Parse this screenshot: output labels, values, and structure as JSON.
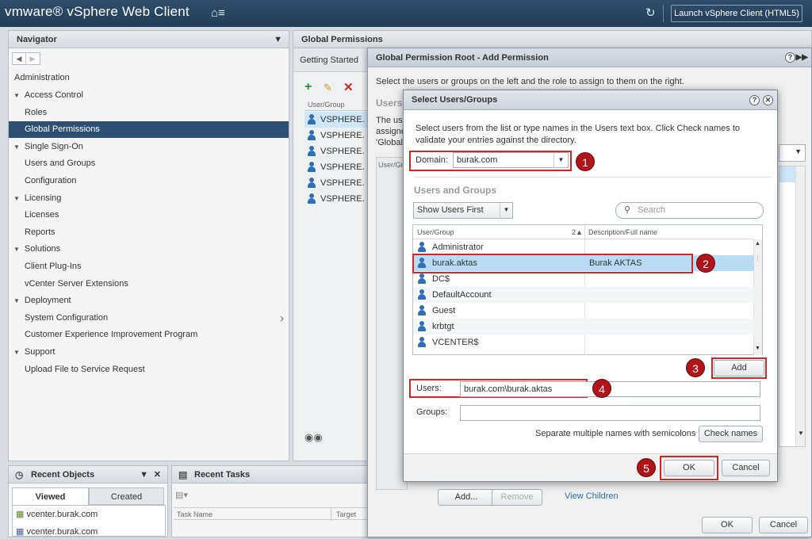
{
  "app": {
    "brand": "vmware® vSphere Web Client",
    "launch_html5": "Launch vSphere Client (HTML5)"
  },
  "navigator": {
    "title": "Navigator",
    "section": "Administration",
    "items": [
      {
        "label": "Access Control",
        "group": true
      },
      {
        "label": "Roles"
      },
      {
        "label": "Global Permissions",
        "selected": true
      },
      {
        "label": "Single Sign-On",
        "group": true
      },
      {
        "label": "Users and Groups"
      },
      {
        "label": "Configuration"
      },
      {
        "label": "Licensing",
        "group": true
      },
      {
        "label": "Licenses"
      },
      {
        "label": "Reports"
      },
      {
        "label": "Solutions",
        "group": true
      },
      {
        "label": "Client Plug-Ins"
      },
      {
        "label": "vCenter Server Extensions"
      },
      {
        "label": "Deployment",
        "group": true
      },
      {
        "label": "System Configuration"
      },
      {
        "label": "Customer Experience Improvement Program"
      },
      {
        "label": "Support",
        "group": true
      },
      {
        "label": "Upload File to Service Request"
      }
    ]
  },
  "global_permissions": {
    "title": "Global Permissions",
    "tab": "Getting Started",
    "list_header": "User/Group",
    "rows": [
      "VSPHERE.",
      "VSPHERE.",
      "VSPHERE.",
      "VSPHERE.",
      "VSPHERE.",
      "VSPHERE."
    ],
    "partial_heading": "Users",
    "partial_text": [
      "The us",
      "assigne",
      "'Global"
    ],
    "partial_col": "User/Gr"
  },
  "recent_objects": {
    "title": "Recent Objects",
    "tabs": [
      "Viewed",
      "Created"
    ],
    "items": [
      "vcenter.burak.com",
      "vcenter.burak.com"
    ]
  },
  "recent_tasks": {
    "title": "Recent Tasks",
    "columns": [
      "Task Name",
      "Target"
    ]
  },
  "add_permission": {
    "title": "Global Permission Root - Add Permission",
    "instruction": "Select the users or groups on the left and the role to assign to them on the right.",
    "buttons": {
      "add": "Add...",
      "remove": "Remove",
      "view_children": "View Children",
      "ok": "OK",
      "cancel": "Cancel"
    }
  },
  "select_users": {
    "title": "Select Users/Groups",
    "instruction_line1": "Select users from the list or type names in the Users text box. Click Check names to",
    "instruction_line2": "validate your entries against the directory.",
    "domain_label": "Domain:",
    "domain_value": "burak.com",
    "section_title": "Users and Groups",
    "filter_value": "Show Users First",
    "search_placeholder": "Search",
    "col_user": "User/Group",
    "col_sort": "2▲",
    "col_desc": "Description/Full name",
    "rows": [
      {
        "name": "Administrator",
        "desc": ""
      },
      {
        "name": "burak.aktas",
        "desc": "Burak AKTAS"
      },
      {
        "name": "DC$",
        "desc": ""
      },
      {
        "name": "DefaultAccount",
        "desc": ""
      },
      {
        "name": "Guest",
        "desc": ""
      },
      {
        "name": "krbtgt",
        "desc": ""
      },
      {
        "name": "VCENTER$",
        "desc": ""
      }
    ],
    "add_button": "Add",
    "users_label": "Users:",
    "users_value": "burak.com\\burak.aktas",
    "groups_label": "Groups:",
    "groups_value": "",
    "separate_hint": "Separate multiple names with semicolons",
    "check_names": "Check names",
    "ok": "OK",
    "cancel": "Cancel"
  },
  "badges": [
    "1",
    "2",
    "3",
    "4",
    "5"
  ]
}
